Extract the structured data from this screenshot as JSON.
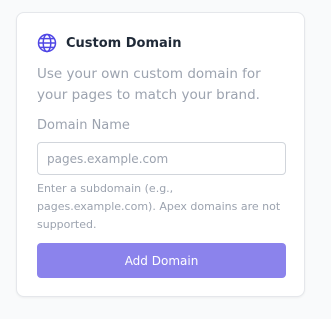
{
  "card": {
    "title": "Custom Domain",
    "icon": "globe-icon",
    "description": "Use your own custom domain for your pages to match your brand.",
    "domain_field": {
      "label": "Domain Name",
      "value": "",
      "placeholder": "pages.example.com"
    },
    "help_text": "Enter a subdomain (e.g., pages.example.com). Apex domains are not supported.",
    "add_button_label": "Add Domain"
  },
  "colors": {
    "accent": "#8b83ec",
    "icon": "#4f46e5",
    "title_text": "#1f2937",
    "muted_text": "#9ca3af",
    "border": "#d1d5db",
    "background": "#f9fafb"
  }
}
